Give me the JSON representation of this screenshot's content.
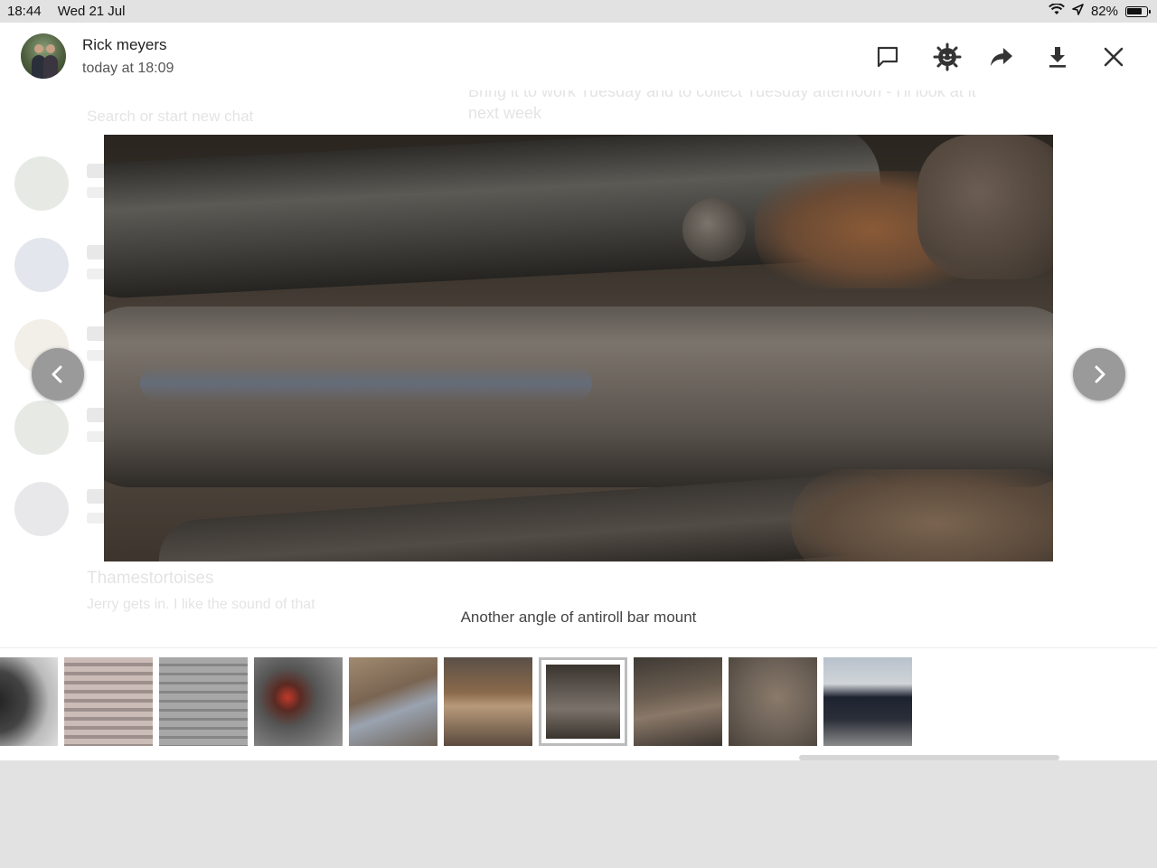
{
  "status_bar": {
    "time": "18:44",
    "date": "Wed 21 Jul",
    "battery_percent": "82%",
    "battery_level": 0.82,
    "icons": [
      "wifi-icon",
      "location-arrow-icon",
      "battery-icon"
    ]
  },
  "header": {
    "sender_name": "Rick meyers",
    "timestamp": "today at 18:09",
    "actions": [
      {
        "name": "reply-button",
        "icon": "speech-bubble-icon"
      },
      {
        "name": "react-button",
        "icon": "add-reaction-icon"
      },
      {
        "name": "forward-button",
        "icon": "share-arrow-icon"
      },
      {
        "name": "download-button",
        "icon": "download-icon"
      },
      {
        "name": "close-button",
        "icon": "close-icon"
      }
    ]
  },
  "viewer": {
    "caption": "Another angle of antiroll bar mount",
    "image_subject": "rusted antiroll bar mount",
    "prev_icon": "chevron-left-icon",
    "next_icon": "chevron-right-icon"
  },
  "background_chat": {
    "snippet1": "Bring it to work Tuesday and to collect Tuesday afternoon - I'll look at it",
    "snippet2": "next week",
    "search_placeholder": "Search or start new chat",
    "contact": "Thamestortoises",
    "contact_preview": "Jerry gets in. I like the sound of that"
  },
  "thumbnails": {
    "selected_index": 6,
    "count": 10,
    "colors": [
      "#3a3a3a",
      "#b8a9a6",
      "#9a9a9a",
      "#6e6a68",
      "#7d6f62",
      "#6a5e52",
      "#5d5750",
      "#4b4742",
      "#6d6258",
      "#2a2e38"
    ]
  },
  "colors": {
    "nav_button": "#9a9a9a",
    "icon_dark": "#333333"
  }
}
